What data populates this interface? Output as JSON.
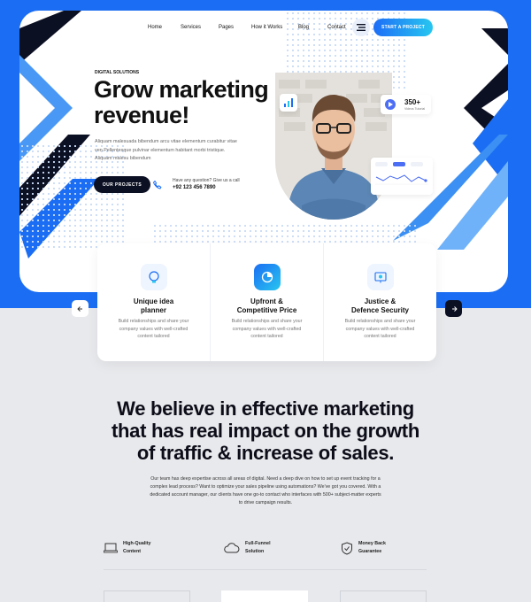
{
  "nav": {
    "items": [
      "Home",
      "Services",
      "Pages",
      "How it Works",
      "Blog",
      "Contact"
    ],
    "cta": "START A PROJECT"
  },
  "hero": {
    "eyebrow": "DIGITAL SOLUTIONS",
    "title_line1": "Grow marketing",
    "title_line2": "revenue!",
    "desc_lines": [
      "Aliquam malesuada bibendum arcu vitae elementum curabitur vitae",
      "ven.Pellentesque pulvinar elementum habitant morbi tristique.",
      "Aliquam malesu bibendum"
    ],
    "button": "OUR PROJECTS",
    "question": "Have any question? Give us a call",
    "phone": "+92 123 456 7890",
    "tutorial_count": "350+",
    "tutorial_label": "Videos Tutorial"
  },
  "features": [
    {
      "title_l1": "Unique idea",
      "title_l2": "planner",
      "text": [
        "Build relationships and share your",
        "company values with well-crafted",
        "content tailored"
      ]
    },
    {
      "title_l1": "Upfront &",
      "title_l2": "Competitive Price",
      "text": [
        "Build relationships and share your",
        "company values with well-crafted",
        "content tailored"
      ]
    },
    {
      "title_l1": "Justice &",
      "title_l2": "Defence Security",
      "text": [
        "Build relationships and share your",
        "company values with well-crafted",
        "content tailored"
      ]
    }
  ],
  "statement": {
    "lines": [
      "We believe in effective marketing",
      "that has real impact on the growth",
      "of traffic & increase of sales."
    ],
    "para": [
      "Our team has deep expertise across all areas of digital. Need a deep dive on how to set up event tracking for a",
      "complex lead process? Want to optimize your sales pipeline using automations? We've got you covered. With a",
      "dedicated account manager, our clients have one go-to contact who interfaces with 500+ subject-matter experts",
      "to drive campaign results."
    ]
  },
  "stats": [
    {
      "l1": "High-Quality",
      "l2": "Content"
    },
    {
      "l1": "Full-Funnel",
      "l2": "Solution"
    },
    {
      "l1": "Money Back",
      "l2": "Guarantee"
    }
  ],
  "colors": {
    "brand": "#1b6ef3",
    "dark": "#0c1023",
    "cyan": "#27c6f0"
  }
}
